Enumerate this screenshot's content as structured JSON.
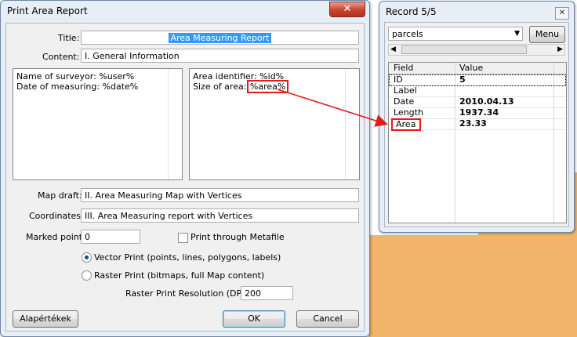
{
  "dialog": {
    "title": "Print Area Report",
    "close_glyph": "✕",
    "title_label": "Title:",
    "title_value": "Area Measuring Report",
    "content_label": "Content:",
    "content_value": "I. General Information",
    "left_text": [
      "Name of surveyor: %user%",
      "Date of measuring: %date%"
    ],
    "right_text_line1": "Area identifier: %id%",
    "right_text_line2_prefix": "Size of area: ",
    "right_text_line2_token": "%area%",
    "map_draft_label": "Map draft:",
    "map_draft_value": "II. Area Measuring Map with Vertices",
    "coordinates_label": "Coordinates:",
    "coordinates_value": "III. Area Measuring report with Vertices",
    "marked_point_label": "Marked point:",
    "marked_point_value": "0",
    "metafile_label": "Print through Metafile",
    "metafile_checked": false,
    "vector_label": "Vector Print (points, lines, polygons, labels)",
    "raster_label": "Raster Print (bitmaps, full Map content)",
    "print_mode": "vector",
    "dpi_label": "Raster Print Resolution (DPI):",
    "dpi_value": "200",
    "defaults_button": "Alapértékek",
    "ok_button": "OK",
    "cancel_button": "Cancel"
  },
  "record": {
    "title": "Record 5/5",
    "layer_value": "parcels",
    "menu_button": "Menu",
    "col_field": "Field",
    "col_value": "Value",
    "rows": [
      {
        "field": "ID",
        "value": "5"
      },
      {
        "field": "Label",
        "value": ""
      },
      {
        "field": "Date",
        "value": "2010.04.13"
      },
      {
        "field": "Length",
        "value": "1937.34"
      },
      {
        "field": "Area",
        "value": "23.33"
      }
    ]
  },
  "colors": {
    "highlight": "#e21b1b",
    "selection": "#3399ff",
    "desktop": "#f0b56a"
  }
}
